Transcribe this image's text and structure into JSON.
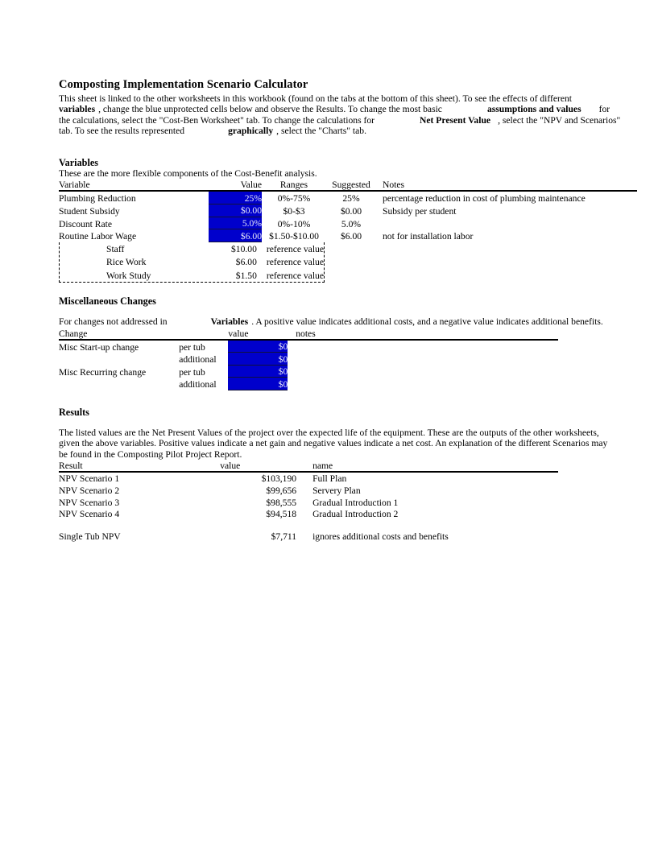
{
  "document": {
    "title": "Composting Implementation Scenario Calculator",
    "intro": {
      "seg1": "This sheet is linked to the other worksheets in this workbook (found on the tabs at the bottom of this sheet).  To see the effects of different",
      "bold1": "variables",
      "seg2": ", change the blue unprotected cells below and observe the Results.  To change the most basic",
      "bold2": "assumptions and values",
      "seg3": "for the calculations, select the \"Cost-Ben Worksheet\" tab.  To change the calculations for",
      "bold3": "Net Present Value",
      "seg4": ", select the \"NPV and Scenarios\" tab.  To see the results represented",
      "bold4": "graphically",
      "seg5": ", select the \"Charts\" tab."
    }
  },
  "variables_section": {
    "heading": "Variables",
    "subtitle": "These are the more flexible components of the Cost-Benefit analysis.",
    "headers": {
      "variable": "Variable",
      "value": "Value",
      "ranges": "Ranges",
      "suggested": "Suggested",
      "notes": "Notes"
    },
    "rows": [
      {
        "variable": "Plumbing Reduction",
        "value": "25%",
        "ranges": "0%-75%",
        "suggested": "25%",
        "notes": "percentage reduction in cost of plumbing maintenance"
      },
      {
        "variable": "Student Subsidy",
        "value": "$0.00",
        "ranges": "$0-$3",
        "suggested": "$0.00",
        "notes": "Subsidy per student"
      },
      {
        "variable": "Discount Rate",
        "value": "5.0%",
        "ranges": "0%-10%",
        "suggested": "5.0%",
        "notes": ""
      },
      {
        "variable": "Routine Labor Wage",
        "value": "$6.00",
        "ranges": "$1.50-$10.00",
        "suggested": "$6.00",
        "notes": "not for installation labor"
      }
    ],
    "reference_rows": [
      {
        "name": "Staff",
        "value": "$10.00",
        "note": "reference value"
      },
      {
        "name": "Rice Work",
        "value": "$6.00",
        "note": "reference value"
      },
      {
        "name": "Work Study",
        "value": "$1.50",
        "note": "reference value"
      }
    ]
  },
  "misc_section": {
    "heading": "Miscellaneous Changes",
    "desc_pre": "For changes not addressed in",
    "desc_bold": "Variables",
    "desc_post": ".  A positive value indicates additional costs, and a negative value indicates additional benefits.",
    "headers": {
      "change": "Change",
      "value": "value",
      "notes": "notes"
    },
    "rows": [
      {
        "change": "Misc Start-up change",
        "per": "per tub",
        "value": "$0",
        "notes": ""
      },
      {
        "change": "",
        "per": "additional",
        "value": "$0",
        "notes": ""
      },
      {
        "change": "Misc Recurring change",
        "per": "per tub",
        "value": "$0",
        "notes": ""
      },
      {
        "change": "",
        "per": "additional",
        "value": "$0",
        "notes": ""
      }
    ]
  },
  "results_section": {
    "heading": "Results",
    "description": "The listed values are the Net Present Values of the project over the expected life of the equipment.  These are the outputs of the other worksheets, given the above variables.  Positive values indicate a net gain and negative values indicate a net cost.  An explanation of the different Scenarios may be found in the Composting Pilot Project Report.",
    "headers": {
      "result": "Result",
      "value": "value",
      "name": "name"
    },
    "rows": [
      {
        "result": "NPV Scenario 1",
        "value": "$103,190",
        "name": "Full Plan"
      },
      {
        "result": "NPV Scenario 2",
        "value": "$99,656",
        "name": "Servery Plan"
      },
      {
        "result": "NPV Scenario 3",
        "value": "$98,555",
        "name": "Gradual Introduction 1"
      },
      {
        "result": "NPV Scenario 4",
        "value": "$94,518",
        "name": "Gradual Introduction 2"
      }
    ],
    "summary_row": {
      "result": "Single Tub NPV",
      "value": "$7,711",
      "name": "ignores additional costs and benefits"
    }
  },
  "colors": {
    "input_cell_bg": "#0000CC",
    "input_cell_text": "#E8E8F8",
    "rule": "#000000"
  }
}
